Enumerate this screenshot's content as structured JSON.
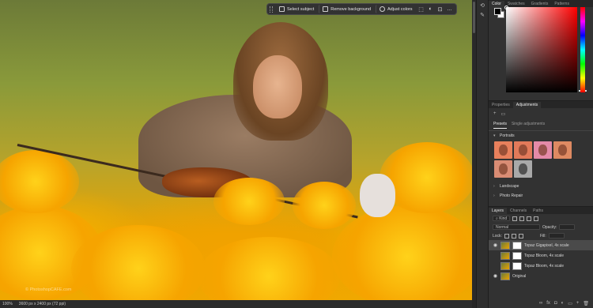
{
  "taskbar": {
    "select_subject": "Select subject",
    "remove_background": "Remove background",
    "adjust_colors": "Adjust colors",
    "more": "..."
  },
  "status": {
    "zoom": "100%",
    "doc_size": "3600 px x 2400 px (72 ppi)"
  },
  "watermark": "© PhotoshopCAFE.com",
  "color_panel": {
    "tabs": [
      "Color",
      "Swatches",
      "Gradients",
      "Patterns"
    ]
  },
  "adjustments_panel": {
    "tabs": [
      "Properties",
      "Adjustments"
    ],
    "subtabs": [
      "Presets",
      "Single adjustments"
    ],
    "groups": {
      "portraits": "Portraits",
      "landscape": "Landscape",
      "photo_repair": "Photo Repair"
    },
    "portrait_thumbs": [
      "warm",
      "warm",
      "pink",
      "warm",
      "warm",
      "bw"
    ]
  },
  "layers_panel": {
    "tabs": [
      "Layers",
      "Channels",
      "Paths"
    ],
    "kind_label": "Kind",
    "blend_mode": "Normal",
    "opacity_label": "Opacity:",
    "lock_label": "Lock:",
    "fill_label": "Fill:",
    "layers": [
      {
        "name": "Topaz Gigapixel, 4x scale",
        "selected": true,
        "visible": true,
        "has_mask": true
      },
      {
        "name": "Topaz Bloom, 4x scale",
        "selected": false,
        "visible": false,
        "has_mask": true
      },
      {
        "name": "Topaz Bloom, 4x scale",
        "selected": false,
        "visible": false,
        "has_mask": true
      },
      {
        "name": "Original",
        "selected": false,
        "visible": true,
        "has_mask": false
      }
    ]
  },
  "colors": {
    "accent": "#f0a800",
    "panel_bg": "#323232"
  }
}
